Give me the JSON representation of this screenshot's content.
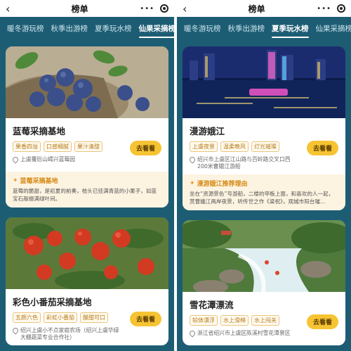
{
  "screens": [
    {
      "title": "榜单",
      "tabs": [
        "暖冬游玩榜",
        "秋季出游榜",
        "夏季玩水榜",
        "仙果采摘榜"
      ],
      "active_tab": 3,
      "cards": [
        {
          "title": "蓝莓采摘基地",
          "tags": [
            "果香四溢",
            "口感细腻",
            "果汁清甜"
          ],
          "location": "上虞覆卮山嶀兴蓝莓园",
          "button": "去看看",
          "rec_title": "蓝莓采摘基地",
          "rec_text": "蓝莓的脆甜，是初夏的前奏，枝头已挂满青蓝的小果子，如蓝宝石般缀满绿叶间。"
        },
        {
          "title": "彩色小番茄采摘基地",
          "tags": [
            "五颜六色",
            "彩虹小番茄",
            "酸甜可口"
          ],
          "location": "绍兴上虞小不点家庭农场（绍兴上虞华绿大棚蔬菜专业合作社）",
          "button": "去看看"
        }
      ]
    },
    {
      "title": "榜单",
      "tabs": [
        "暖冬游玩榜",
        "秋季出游榜",
        "夏季玩水榜",
        "仙果采摘榜"
      ],
      "active_tab": 2,
      "cards": [
        {
          "title": "漫游娥江",
          "tags": [
            "上虞夜景",
            "温柔晚风",
            "灯光璀璨"
          ],
          "location": "绍兴市上虞区江山路与百岭路交叉口西200米曹娥江游船",
          "button": "去看看",
          "rec_title": "漫游娥江推荐理由",
          "rec_text": "坐在“资源景色”号游船，二楼的甲板上面，和喜欢的人一起，赏曹娥江两岸夜景，听传世之作《梁祝》，观城市阳台璀..."
        },
        {
          "title": "雪花潭漂流",
          "tags": [
            "较体漂浮",
            "水上滑梯",
            "水上闯关"
          ],
          "location": "浙江省绍兴市上虞区陈溪村雪花潭景区",
          "button": "去看看"
        }
      ]
    }
  ]
}
